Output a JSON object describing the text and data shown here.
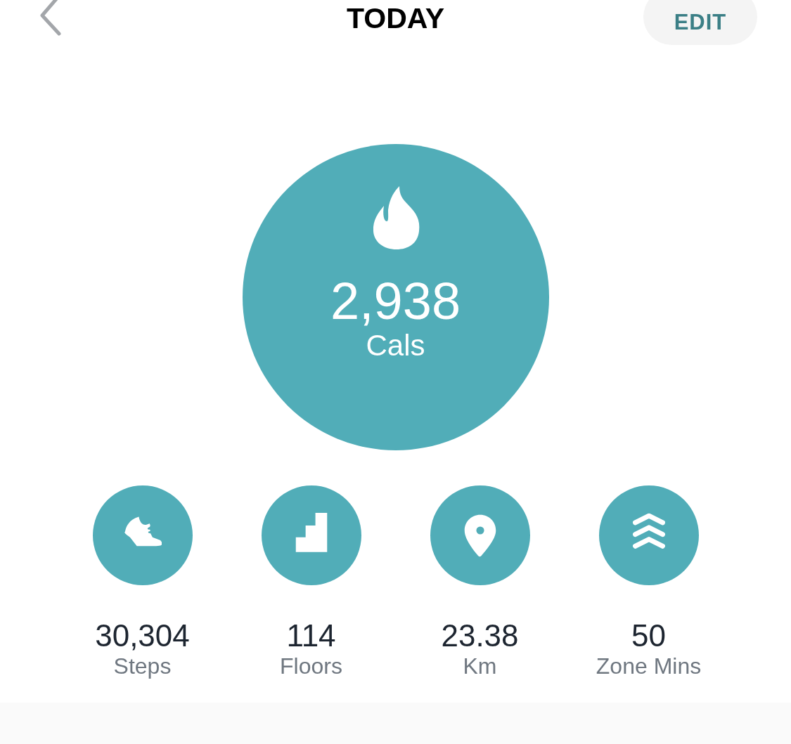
{
  "header": {
    "title": "TODAY",
    "edit_button": "EDIT"
  },
  "main_stat": {
    "value": "2,938",
    "label": "Cals"
  },
  "stats": [
    {
      "kind": "steps",
      "value": "30,304",
      "label": "Steps"
    },
    {
      "kind": "floors",
      "value": "114",
      "label": "Floors"
    },
    {
      "kind": "distance",
      "value": "23.38",
      "label": "Km"
    },
    {
      "kind": "zone",
      "value": "50",
      "label": "Zone Mins"
    }
  ]
}
